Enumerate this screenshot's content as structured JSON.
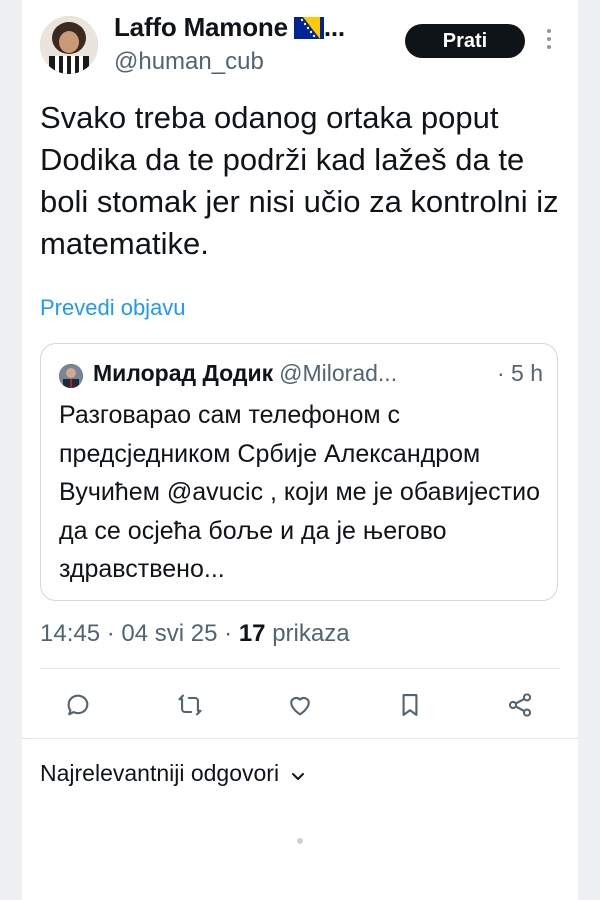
{
  "post": {
    "author_name": "Laffo Mamone",
    "author_ellipsis": "...",
    "author_handle": "@human_cub",
    "follow_label": "Prati",
    "text": "Svako treba odanog ortaka poput Dodika da te podrži kad lažeš da te boli stomak jer nisi učio za kontrolni iz matematike.",
    "translate_label": "Prevedi objavu"
  },
  "quoted_post": {
    "author_name": "Милорад Додик",
    "author_handle": "@Milorad...",
    "time": "· 5 h",
    "text": "Разговарао сам телефоном с предсједником Србије Александром Вучићем @avucic , који ме је обавијестио да се осјећа боље и да је његово здравствено..."
  },
  "meta": {
    "time": "14:45",
    "separator": "·",
    "date": "04 svi 25",
    "views_count": "17",
    "views_label": "prikaza"
  },
  "actions": [
    {
      "icon": "reply-icon"
    },
    {
      "icon": "repost-icon"
    },
    {
      "icon": "like-icon"
    },
    {
      "icon": "bookmark-icon"
    },
    {
      "icon": "share-icon"
    }
  ],
  "replies": {
    "sort_label": "Najrelevantniji odgovori"
  },
  "colors": {
    "link": "#1d9bf0",
    "text": "#0f1419",
    "secondary": "#536471",
    "follow_bg": "#0f1419"
  }
}
